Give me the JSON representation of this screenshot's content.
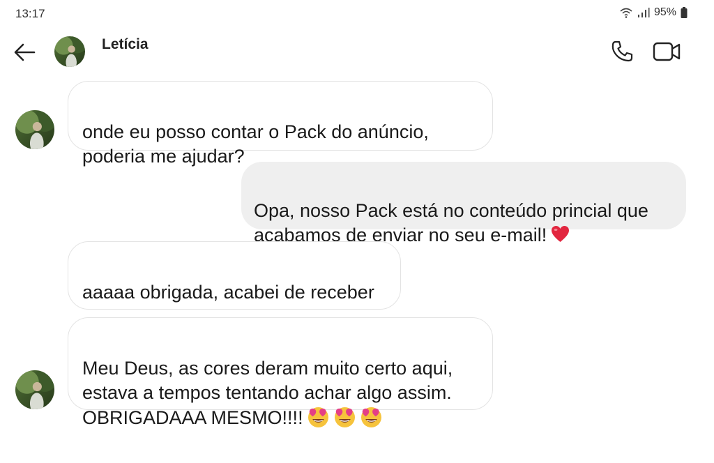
{
  "status_bar": {
    "time": "13:17",
    "battery": "95%"
  },
  "header": {
    "contact_name": "Letícia"
  },
  "messages": [
    {
      "direction": "in",
      "text": "onde eu posso contar o Pack do anúncio,\npoderia me ajudar?"
    },
    {
      "direction": "out",
      "text": "Opa, nosso Pack está no conteúdo princial que\nacabamos de enviar no seu e-mail!",
      "emoji": "heart"
    },
    {
      "direction": "in",
      "text": "aaaaa obrigada, acabei de receber"
    },
    {
      "direction": "in",
      "text": "Meu Deus, as cores deram muito certo aqui,\nestava a tempos tentando achar algo assim.\nOBRIGADAAA MESMO!!!!",
      "emoji": "heart-eyes-face x3"
    }
  ],
  "colors": {
    "incoming_bubble_bg": "#ffffff",
    "incoming_bubble_border": "#e3e3e3",
    "outgoing_bubble_bg": "#efefef",
    "heart": "#e2263f",
    "emoji_face": "#f6c33c"
  }
}
